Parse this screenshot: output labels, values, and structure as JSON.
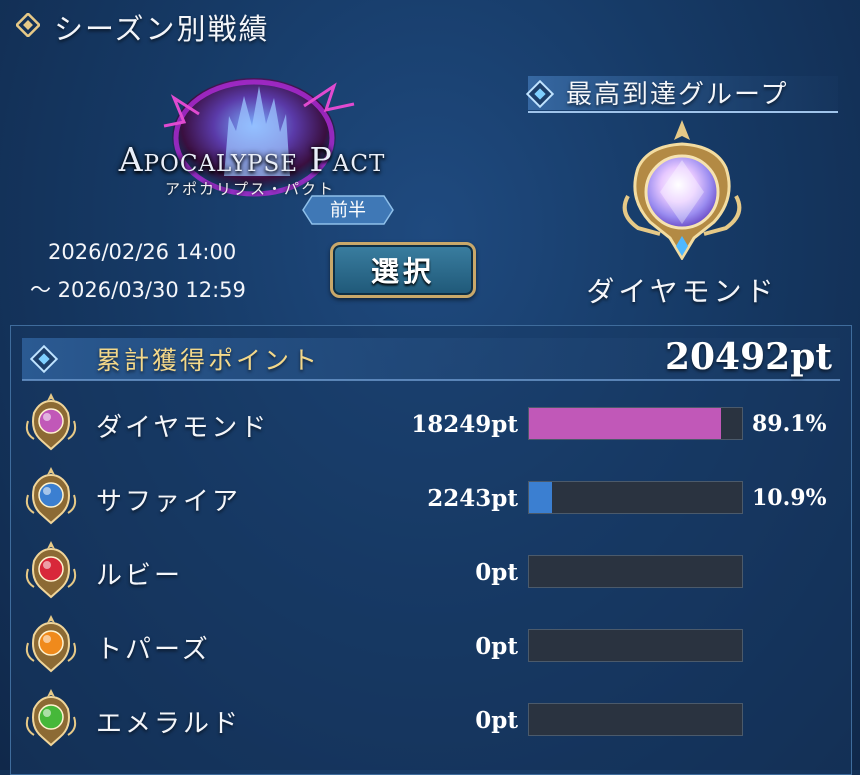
{
  "header": {
    "title": "シーズン別戦績"
  },
  "season": {
    "logo_en": "Apocalypse Pact",
    "logo_jp": "アポカリプス・パクト",
    "half": "前半",
    "date_start": "2026/02/26 14:00",
    "date_end": "～ 2026/03/30 12:59",
    "select_label": "選択"
  },
  "highest_group": {
    "title": "最高到達グループ",
    "name": "ダイヤモンド"
  },
  "points": {
    "title": "累計獲得ポイント",
    "total": "20492pt",
    "rows": [
      {
        "name": "ダイヤモンド",
        "pts": "18249pt",
        "pct": "89.1%",
        "fraction": 0.891,
        "color": "#c158b8",
        "icon": "diamond-gem-icon"
      },
      {
        "name": "サファイア",
        "pts": "2243pt",
        "pct": "10.9%",
        "fraction": 0.109,
        "color": "#3b7fd1",
        "icon": "sapphire-gem-icon"
      },
      {
        "name": "ルビー",
        "pts": "0pt",
        "pct": "",
        "fraction": 0,
        "color": "#d8283a",
        "icon": "ruby-gem-icon"
      },
      {
        "name": "トパーズ",
        "pts": "0pt",
        "pct": "",
        "fraction": 0,
        "color": "#f08a1c",
        "icon": "topaz-gem-icon"
      },
      {
        "name": "エメラルド",
        "pts": "0pt",
        "pct": "",
        "fraction": 0,
        "color": "#46b83a",
        "icon": "emerald-gem-icon"
      }
    ]
  }
}
